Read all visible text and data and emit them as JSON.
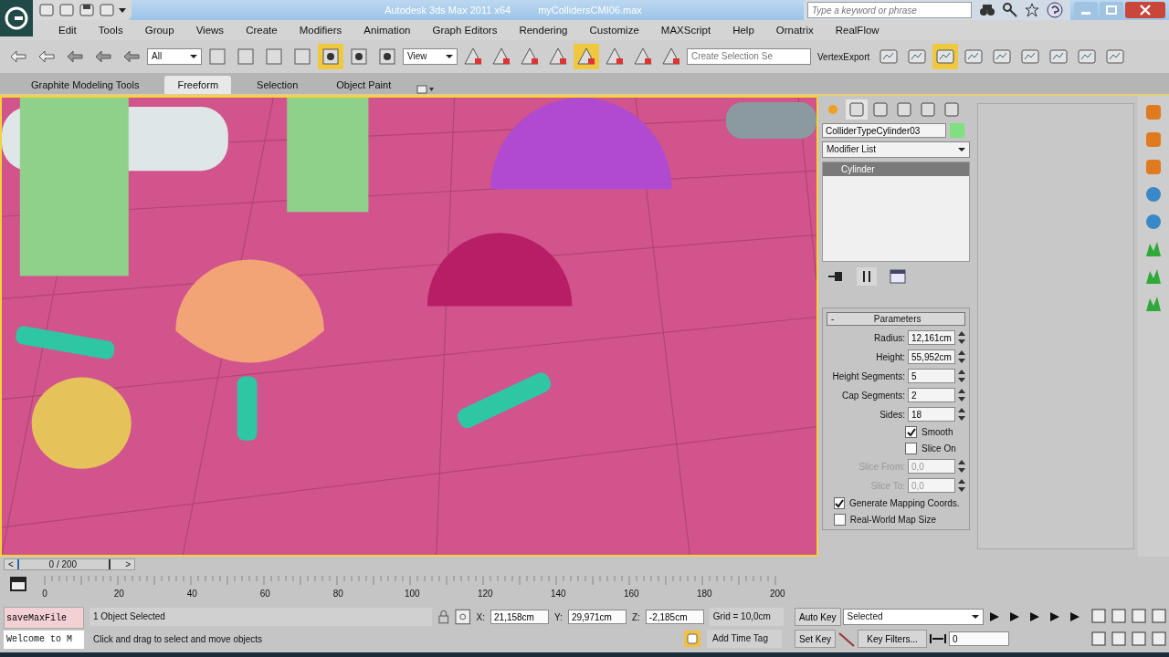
{
  "window": {
    "title": "Autodesk 3ds Max 2011 x64",
    "file": "myCollidersCMI06.max"
  },
  "search": {
    "placeholder": "Type a keyword or phrase"
  },
  "menu": [
    "Edit",
    "Tools",
    "Group",
    "Views",
    "Create",
    "Modifiers",
    "Animation",
    "Graph Editors",
    "Rendering",
    "Customize",
    "MAXScript",
    "Help",
    "Ornatrix",
    "RealFlow"
  ],
  "toolbar": {
    "selection_filter": "All",
    "reference_coord": "View",
    "named_selection": {
      "placeholder": "Create Selection Se"
    },
    "plugin_label": "VertexExport"
  },
  "ribbon_tabs": [
    {
      "label": "Graphite Modeling Tools",
      "selected": false
    },
    {
      "label": "Freeform",
      "selected": true
    },
    {
      "label": "Selection",
      "selected": false
    },
    {
      "label": "Object Paint",
      "selected": false
    }
  ],
  "command_panel": {
    "object_name": "ColliderTypeCylinder03",
    "modifier_list": "Modifier List",
    "stack": [
      {
        "label": "Cylinder",
        "selected": true
      }
    ],
    "rollout": {
      "toggle": "-",
      "title": "Parameters"
    },
    "params": [
      {
        "kind": "spinner",
        "label": "Radius:",
        "value": "12,161cm",
        "disabled": false
      },
      {
        "kind": "spinner",
        "label": "Height:",
        "value": "55,952cm",
        "disabled": false
      },
      {
        "kind": "spinner",
        "label": "Height Segments:",
        "value": "5",
        "disabled": false
      },
      {
        "kind": "spinner",
        "label": "Cap Segments:",
        "value": "2",
        "disabled": false
      },
      {
        "kind": "spinner",
        "label": "Sides:",
        "value": "18",
        "disabled": false
      },
      {
        "kind": "checkbox",
        "label": "Smooth",
        "checked": true
      },
      {
        "kind": "checkbox",
        "label": "Slice On",
        "checked": false
      },
      {
        "kind": "spinner",
        "label": "Slice From:",
        "value": "0,0",
        "disabled": true
      },
      {
        "kind": "spinner",
        "label": "Slice To:",
        "value": "0,0",
        "disabled": true
      },
      {
        "kind": "wide_checkbox",
        "label": "Generate Mapping Coords.",
        "checked": true
      },
      {
        "kind": "wide_checkbox",
        "label": "Real-World Map Size",
        "checked": false
      }
    ]
  },
  "time_slider": {
    "prev": "<",
    "position": "0 / 200",
    "level": 0,
    "next": ">"
  },
  "track_ticks": [
    "0",
    "20",
    "40",
    "60",
    "80",
    "100",
    "120",
    "140",
    "160",
    "180",
    "200"
  ],
  "status": {
    "script_line": "saveMaxFile",
    "script_output": "Welcome to M",
    "selection": "1 Object Selected",
    "prompt": "Click and drag to select and move objects",
    "x_label": "X:",
    "x": "21,158cm",
    "y_label": "Y:",
    "y": "29,971cm",
    "z_label": "Z:",
    "z": "-2,185cm",
    "grid": "Grid = 10,0cm",
    "time_tag": "Add Time Tag"
  },
  "animation": {
    "auto_key": "Auto Key",
    "set_key": "Set Key",
    "key_mode": "Selected",
    "key_filters": "Key Filters...",
    "frame": "0"
  }
}
